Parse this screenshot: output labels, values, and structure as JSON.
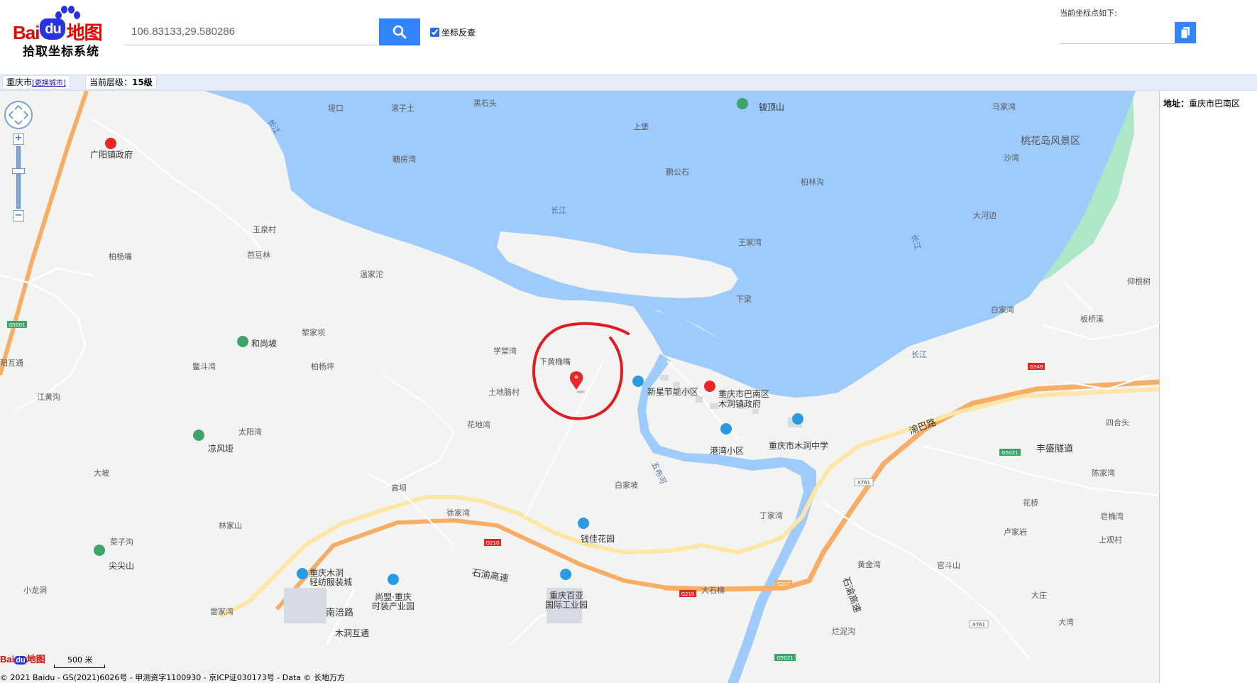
{
  "header": {
    "logo_brand_bai": "Bai",
    "logo_brand_du": "du",
    "logo_brand_map": "地图",
    "logo_subtitle": "拾取坐标系统",
    "search_value": "106.83133,29.580286",
    "reverse_label": "坐标反查",
    "reverse_checked": true,
    "coord_title": "当前坐标点如下:",
    "coord_output": ""
  },
  "info_bar": {
    "city": "重庆市",
    "change_city": "[更换城市]",
    "level_prefix": "当前层级：",
    "level_value": "15级"
  },
  "side_panel": {
    "address_label": "地址：",
    "address_value": "重庆市巴南区"
  },
  "map": {
    "scale": "500 米",
    "copyright": "© 2021 Baidu - GS(2021)6026号 - 甲测资字1100930 - 京ICP证030173号 - Data © 长地万方",
    "logo_bai": "Bai",
    "logo_du": "du",
    "logo_map": "地图",
    "colors": {
      "water": "#9ecbfb",
      "land": "#f3f3f1",
      "park": "#aee7c7",
      "highway": "#f7ad66",
      "road": "#fde6a8",
      "marker": "#e8262a",
      "annotation": "#e11b22"
    },
    "labels": {
      "yakou": "垭口",
      "gunzitu": "滚子土",
      "heishitou": "黑石头",
      "bodingshan": "钹顶山",
      "majiawan": "马家湾",
      "changjiang_nw": "长江",
      "guangyang_gov": "广阳镇政府",
      "shangbao": "上堡",
      "taohuadao": "桃花岛风景区",
      "tangfangwan": "糖房湾",
      "shawan": "沙湾",
      "pengonshi": "鹏公石",
      "bailingou": "柏林沟",
      "changjiang_mid": "长江",
      "dahebian": "大河边",
      "yuquancun": "玉泉村",
      "wangjiawan": "王家湾",
      "changjiang_e": "长江",
      "bolinzui": "柏杨嘴",
      "badoulin": "芭豆林",
      "wenjiatuo": "温家沱",
      "yangenshu": "仰根树",
      "xialiang": "下梁",
      "baijiawan_e": "白家湾",
      "banqiaoxi": "板桥溪",
      "lijiaba": "黎家坝",
      "heshangpo": "和尚坡",
      "xuetangwan": "学堂湾",
      "xiahuangjiaozui": "下黄桷嘴",
      "changjiang_s": "长江",
      "hutong": "阳互通",
      "doudouwan": "鳖斗湾",
      "boyangping": "柏杨坪",
      "tudinaocun": "土地脑村",
      "xinxing": "新星节能小区",
      "banan_gov": "重庆市巴南区",
      "mudong_gov": "木洞镇政府",
      "jianghuanggou": "江黄沟",
      "huadiwan": "花地湾",
      "yubalu": "渝巴路",
      "sihetou": "四合头",
      "taiyangwan": "太阳湾",
      "gangwan": "港湾小区",
      "mudong_school": "重庆市木洞中学",
      "fengshengsuidao": "丰盛隧道",
      "liangfengya": "凉风垭",
      "dapo": "大坡",
      "wudongxi": "五布河",
      "chenjiawan": "陈家湾",
      "gaoba": "高坝",
      "baijiapo": "白家坡",
      "huaqiao": "花桥",
      "xujiawan": "徐家湾",
      "dingjiawan": "丁家湾",
      "zaojiaowan": "皂桷湾",
      "linjiashan": "林家山",
      "lujiaoyan": "卢家岩",
      "shangguancun": "上观村",
      "caizigou": "菜子沟",
      "qianjia": "钱佳花园",
      "jianjianshan": "尖尖山",
      "huangjinwan": "黄金湾",
      "guandoushan": "官斗山",
      "shiyugaosu": "石渝高速",
      "shiyugaosu2": "石渝高速",
      "xiaolongdong": "小龙洞",
      "fangzhi": "重庆木洞\n轻纺服装城",
      "shangmeng": "尚盟·重庆\n时装产业园",
      "baiya": "重庆百亚\n国际工业园",
      "dashiti": "大石梯",
      "dazhuang": "大庄",
      "leijiawan": "雷家湾",
      "nanfulu": "南涪路",
      "dawan": "大湾",
      "mudonghutong": "木洞互通",
      "lanniwan": "烂泥沟"
    },
    "shields": {
      "g5001": "G5001",
      "g348": "G348",
      "g5021a": "G5021",
      "x761a": "X761",
      "g210a": "G210",
      "g210b": "G210",
      "s207": "S207",
      "g5021b": "G5021",
      "x761b": "X761"
    }
  }
}
